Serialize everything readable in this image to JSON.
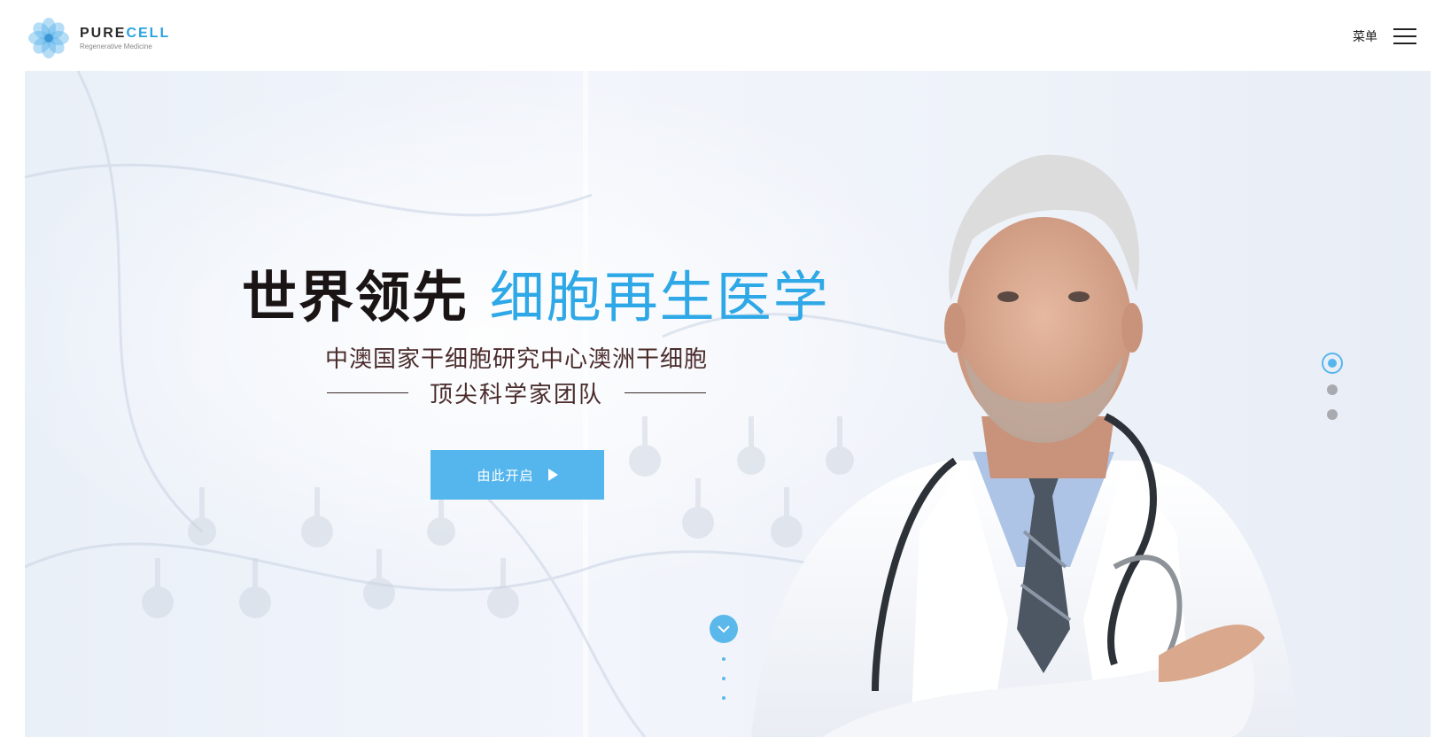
{
  "header": {
    "logo_pure": "PURE",
    "logo_cell": "CELL",
    "logo_tagline": "Regenerative Medicine",
    "menu_label": "菜单"
  },
  "hero": {
    "headline_dark": "世界领先",
    "headline_blue": "细胞再生医学",
    "subtitle_line1": "中澳国家干细胞研究中心澳洲干细胞",
    "subtitle_line2": "顶尖科学家团队",
    "cta_label": "由此开启",
    "slides": {
      "count": 3,
      "active_index": 0
    }
  },
  "colors": {
    "accent": "#2ea8e6",
    "button": "#55b6ee",
    "headline_dark": "#1b1414",
    "subtitle": "#4a2b2b",
    "inactive_dot": "#a9aab0"
  },
  "icons": [
    "logo-flower-icon",
    "hamburger-menu-icon",
    "play-arrow-icon",
    "chevron-down-icon"
  ]
}
